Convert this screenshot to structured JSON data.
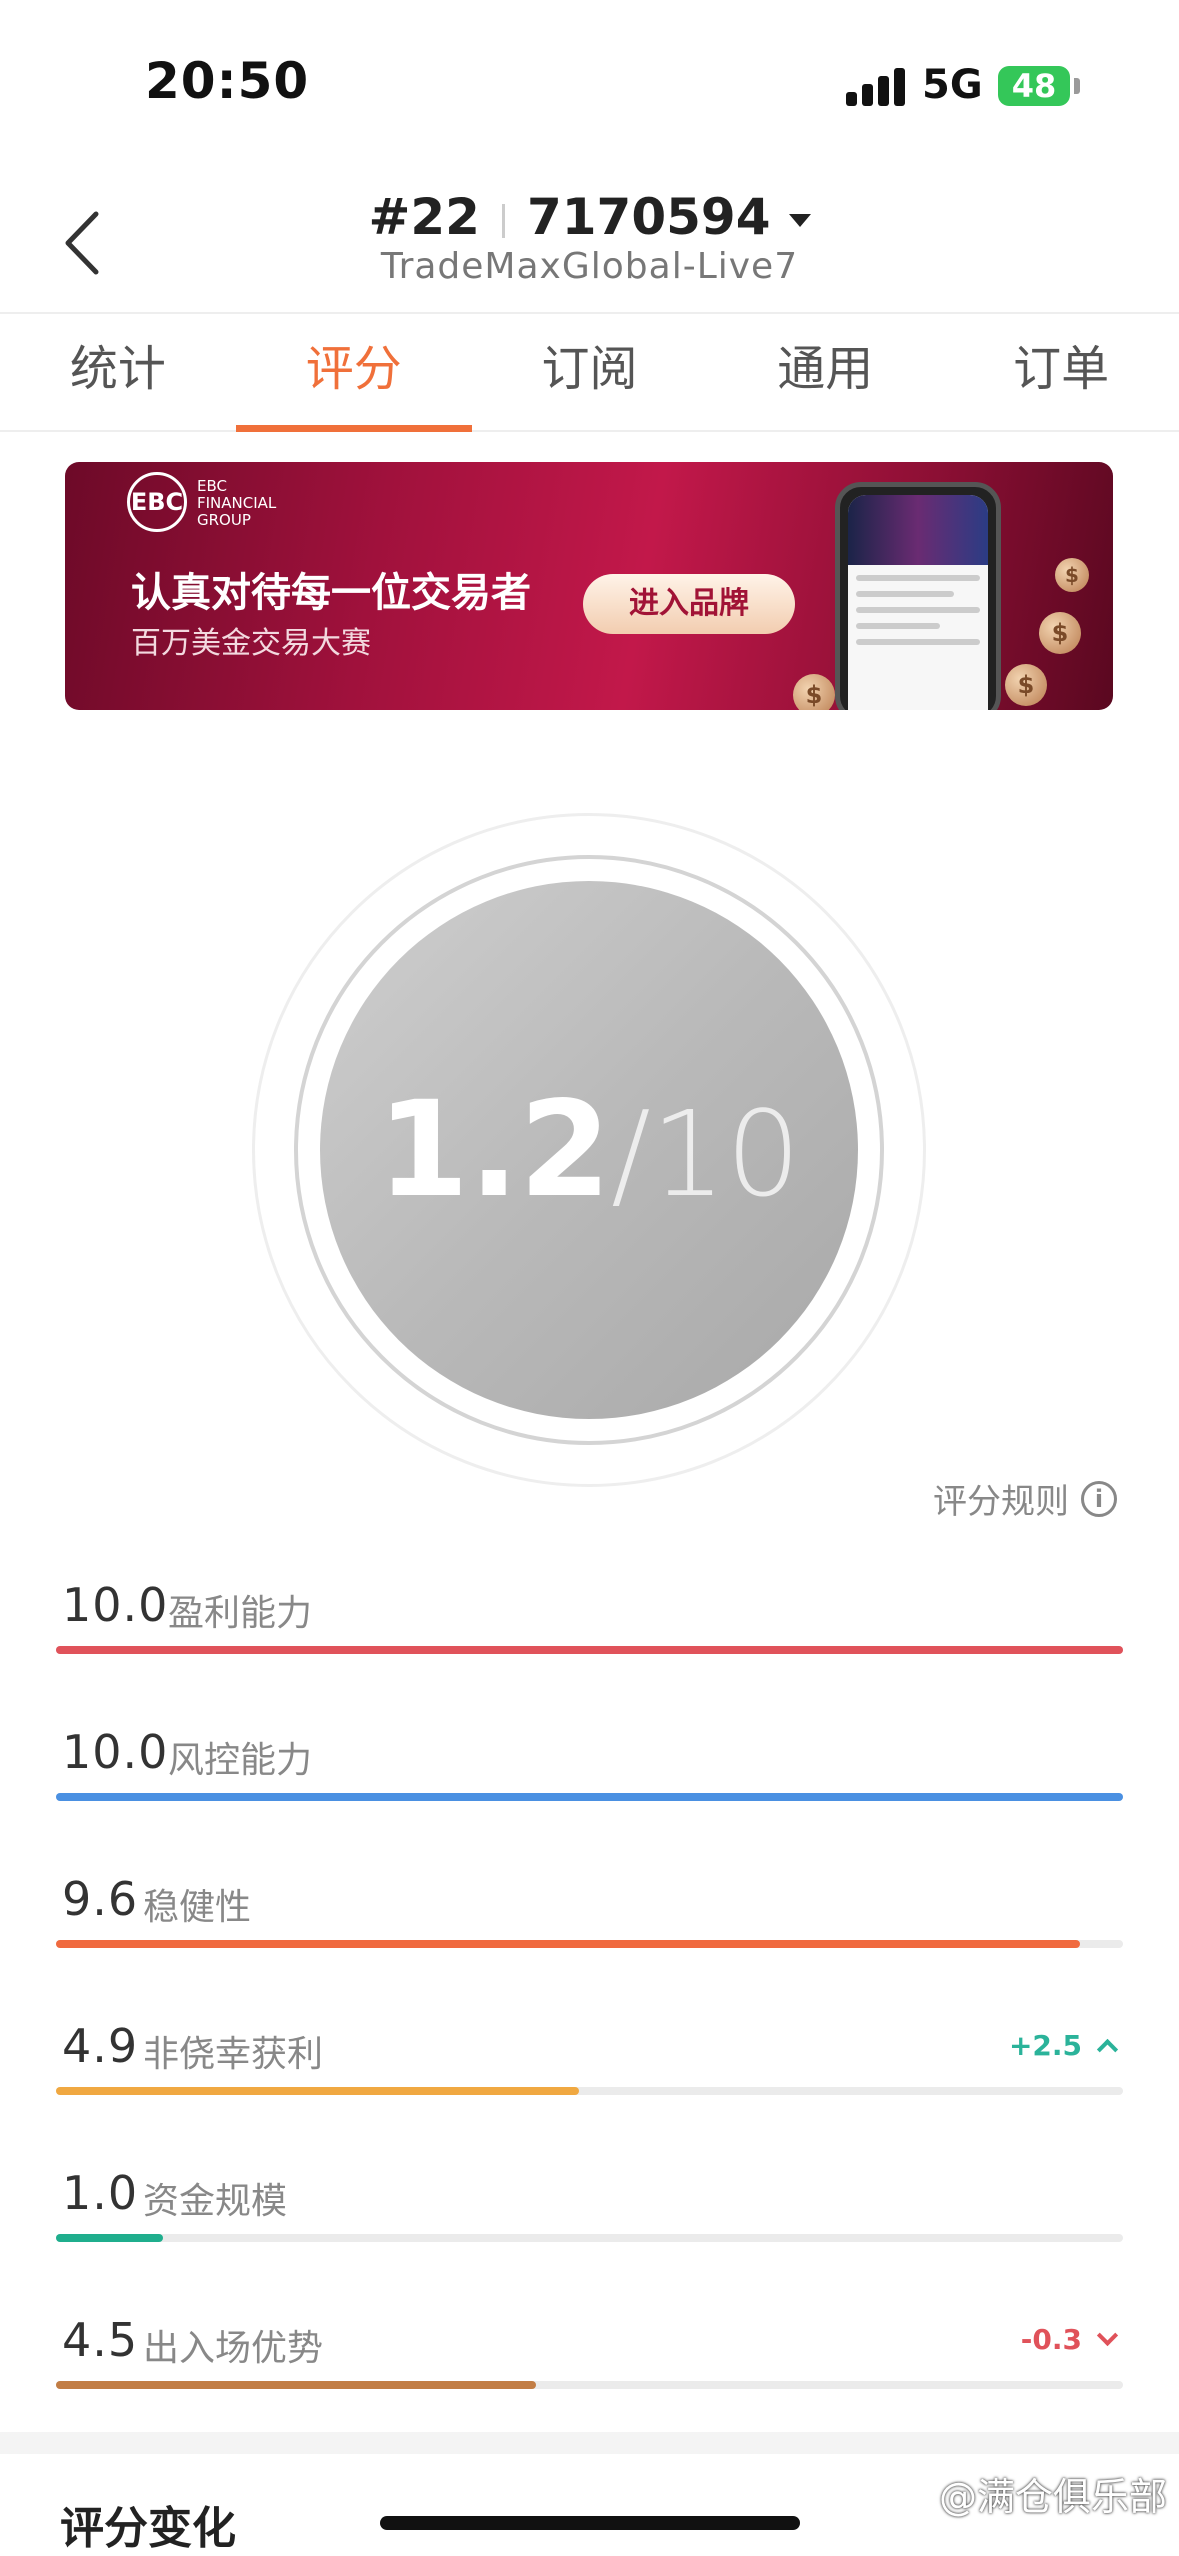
{
  "status": {
    "time": "20:50",
    "network": "5G",
    "battery": "48"
  },
  "header": {
    "rank": "#22",
    "account": "7170594",
    "server": "TradeMaxGlobal-Live7"
  },
  "tabs": [
    {
      "label": "统计"
    },
    {
      "label": "评分"
    },
    {
      "label": "订阅"
    },
    {
      "label": "通用"
    },
    {
      "label": "订单"
    }
  ],
  "banner": {
    "logo_mark": "EBC",
    "logo_lines": [
      "EBC",
      "FINANCIAL",
      "GROUP"
    ],
    "headline": "认真对待每一位交易者",
    "subline": "百万美金交易大赛",
    "button": "进入品牌"
  },
  "score": {
    "value": "1.2",
    "max": "/10"
  },
  "rules_link": "评分规则",
  "metrics": [
    {
      "value": "10.0",
      "label": "盈利能力",
      "fraction": 1.0,
      "color": "#e0525a",
      "change": ""
    },
    {
      "value": "10.0",
      "label": "风控能力",
      "fraction": 1.0,
      "color": "#4a90e2",
      "change": ""
    },
    {
      "value": "9.6",
      "label": "稳健性",
      "fraction": 0.96,
      "color": "#f06a3f",
      "change": ""
    },
    {
      "value": "4.9",
      "label": "非侥幸获利",
      "fraction": 0.49,
      "color": "#f0a841",
      "change": "+2.5",
      "direction": "up",
      "change_color": "#2bb39a"
    },
    {
      "value": "1.0",
      "label": "资金规模",
      "fraction": 0.1,
      "color": "#1fae8d",
      "change": ""
    },
    {
      "value": "4.5",
      "label": "出入场优势",
      "fraction": 0.45,
      "color": "#c27d45",
      "change": "-0.3",
      "direction": "down",
      "change_color": "#e0525a"
    }
  ],
  "section_title": "评分变化",
  "watermark": "@满仓俱乐部"
}
